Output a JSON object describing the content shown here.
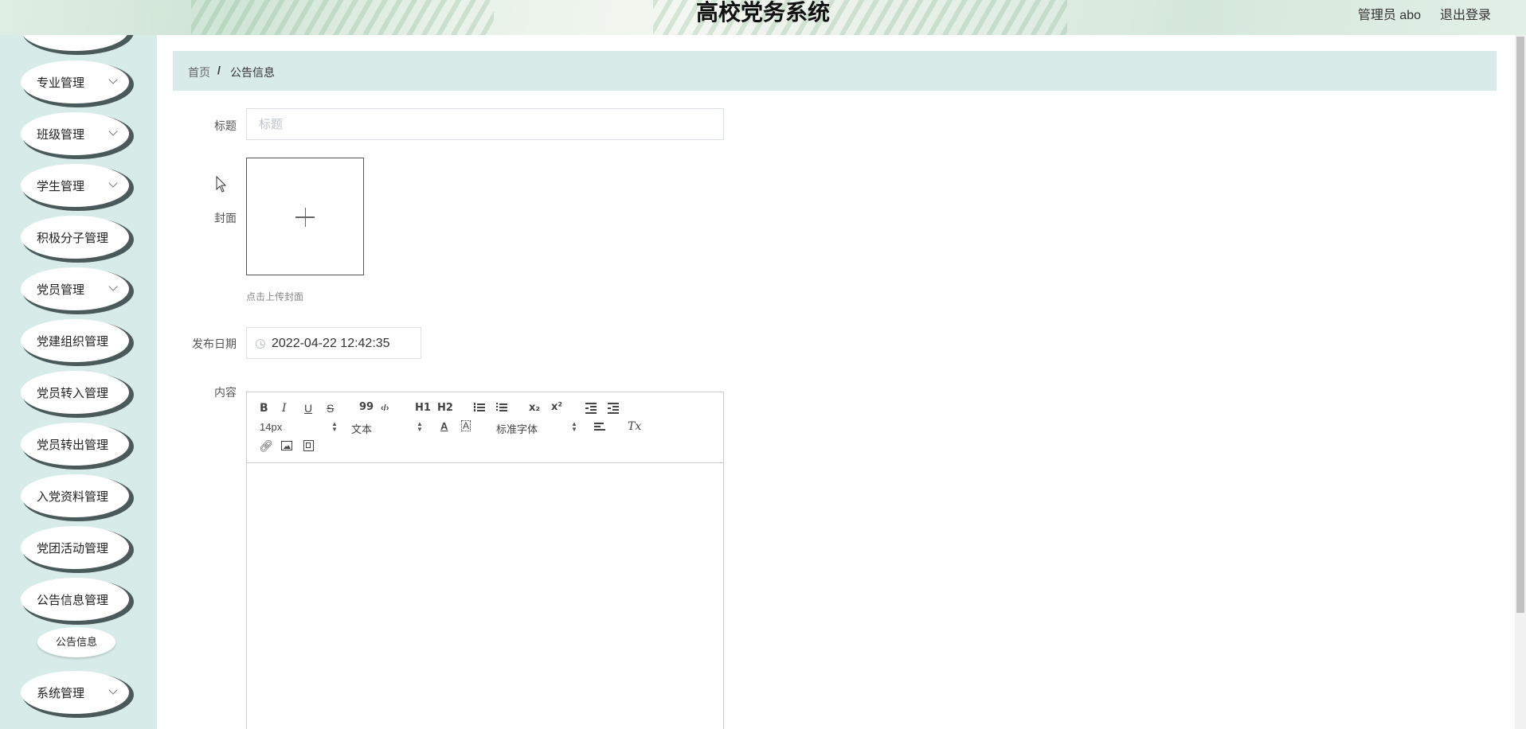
{
  "header": {
    "title": "高校党务系统",
    "user": "管理员 abo",
    "logout": "退出登录"
  },
  "sidebar": {
    "items": [
      {
        "label": "专业管理",
        "chevron": true
      },
      {
        "label": "班级管理",
        "chevron": true
      },
      {
        "label": "学生管理",
        "chevron": true
      },
      {
        "label": "积极分子管理",
        "chevron": false
      },
      {
        "label": "党员管理",
        "chevron": true
      },
      {
        "label": "党建组织管理",
        "chevron": false
      },
      {
        "label": "党员转入管理",
        "chevron": false
      },
      {
        "label": "党员转出管理",
        "chevron": false
      },
      {
        "label": "入党资料管理",
        "chevron": false
      },
      {
        "label": "党团活动管理",
        "chevron": false
      },
      {
        "label": "公告信息管理",
        "chevron": false
      },
      {
        "label": "系统管理",
        "chevron": true
      }
    ],
    "sub_item": "公告信息"
  },
  "breadcrumb": {
    "home": "首页",
    "separator": "/",
    "current": "公告信息"
  },
  "form": {
    "title_label": "标题",
    "title_placeholder": "标题",
    "title_value": "",
    "cover_label": "封面",
    "cover_tip": "点击上传封面",
    "date_label": "发布日期",
    "date_value": "2022-04-22 12:42:35",
    "content_label": "内容"
  },
  "editor": {
    "bold": "B",
    "italic": "I",
    "underline": "U",
    "strike": "S",
    "blockquote": "99",
    "code": "‹/›",
    "h1": "H1",
    "h2": "H2",
    "subscript": "x₂",
    "superscript": "x²",
    "font_size": "14px",
    "header_select": "文本",
    "font_family": "标准字体",
    "clear_format": "Tx",
    "content": ""
  },
  "icons": {
    "upload": "plus-icon",
    "date": "clock-icon",
    "chevron": "chevron-down-icon"
  }
}
